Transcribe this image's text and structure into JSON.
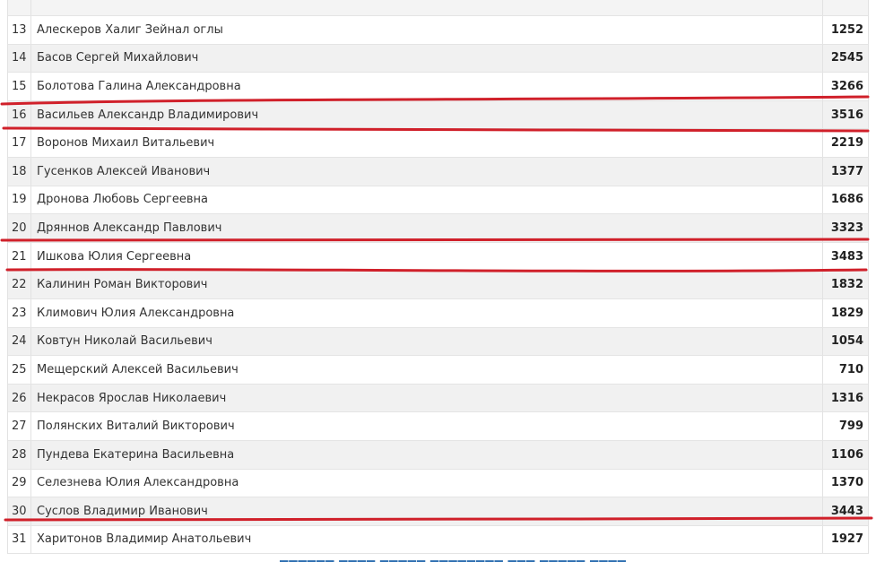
{
  "rows": [
    {
      "n": "13",
      "name": "Алескеров Халиг Зейнал оглы",
      "value": "1252"
    },
    {
      "n": "14",
      "name": "Басов Сергей Михайлович",
      "value": "2545"
    },
    {
      "n": "15",
      "name": "Болотова Галина Александровна",
      "value": "3266"
    },
    {
      "n": "16",
      "name": "Васильев Александр Владимирович",
      "value": "3516"
    },
    {
      "n": "17",
      "name": "Воронов Михаил Витальевич",
      "value": "2219"
    },
    {
      "n": "18",
      "name": "Гусенков Алексей Иванович",
      "value": "1377"
    },
    {
      "n": "19",
      "name": "Дронова Любовь Сергеевна",
      "value": "1686"
    },
    {
      "n": "20",
      "name": "Дряннов Александр Павлович",
      "value": "3323"
    },
    {
      "n": "21",
      "name": "Ишкова Юлия Сергеевна",
      "value": "3483"
    },
    {
      "n": "22",
      "name": "Калинин Роман Викторович",
      "value": "1832"
    },
    {
      "n": "23",
      "name": "Климович Юлия Александровна",
      "value": "1829"
    },
    {
      "n": "24",
      "name": "Ковтун Николай Васильевич",
      "value": "1054"
    },
    {
      "n": "25",
      "name": "Мещерский Алексей Васильевич",
      "value": "710"
    },
    {
      "n": "26",
      "name": "Некрасов Ярослав Николаевич",
      "value": "1316"
    },
    {
      "n": "27",
      "name": "Полянских Виталий Викторович",
      "value": "799"
    },
    {
      "n": "28",
      "name": "Пундева Екатерина Васильевна",
      "value": "1106"
    },
    {
      "n": "29",
      "name": "Селезнева Юлия Александровна",
      "value": "1370"
    },
    {
      "n": "30",
      "name": "Суслов Владимир Иванович",
      "value": "3443"
    },
    {
      "n": "31",
      "name": "Харитонов Владимир Анатольевич",
      "value": "1927"
    }
  ],
  "colors": {
    "underline": "#d0202a",
    "link": "#2a6db0",
    "row_alt": "#f1f1f1"
  }
}
